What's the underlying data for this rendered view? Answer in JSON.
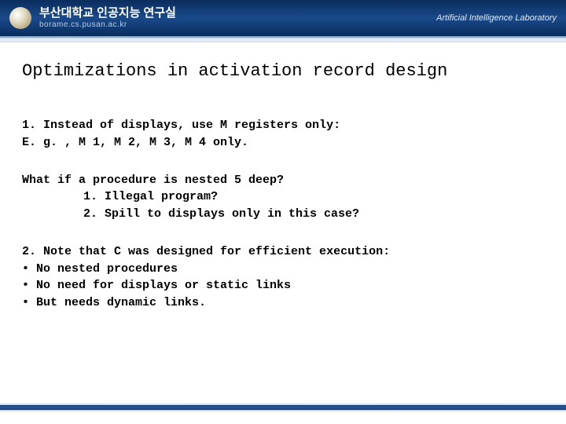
{
  "header": {
    "korean_title": "부산대학교 인공지능 연구실",
    "subtitle": "borame.cs.pusan.ac.kr",
    "lab_name": "Artificial Intelligence Laboratory"
  },
  "slide": {
    "title": "Optimizations in activation record design",
    "section1_line1": "1. Instead of displays, use M registers only:",
    "section1_line2": "E. g. , M 1, M 2, M 3, M 4 only.",
    "section2_line1": "What if a procedure is nested 5 deep?",
    "section2_line2": "1. Illegal program?",
    "section2_line3": "2. Spill to displays only in this case?",
    "section3_line1": "2. Note that C was designed for efficient execution:",
    "section3_line2": "• No nested procedures",
    "section3_line3": "• No need for displays or static links",
    "section3_line4": "• But needs dynamic links."
  }
}
